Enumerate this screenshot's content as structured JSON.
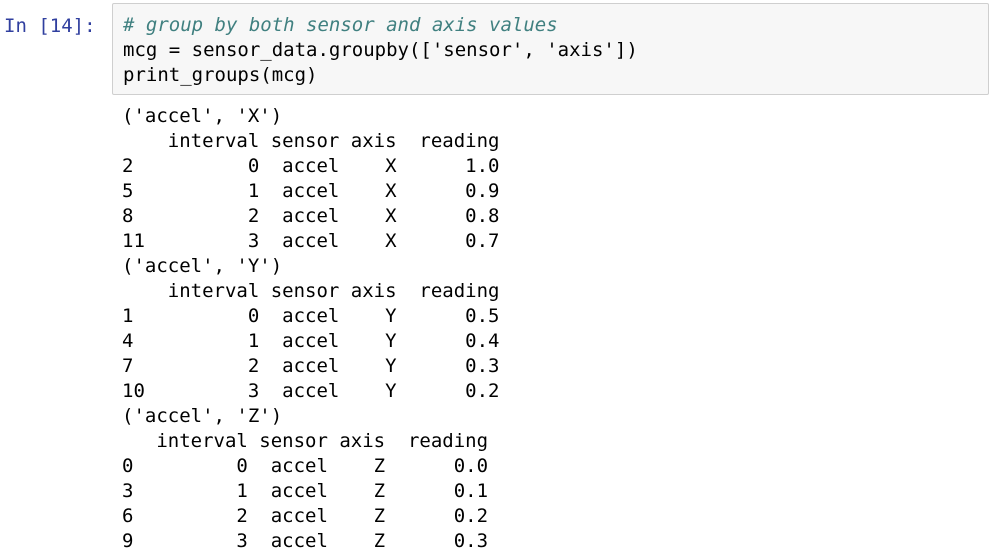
{
  "cell": {
    "prompt": "In [14]:",
    "code_lines": [
      "# group by both sensor and axis values",
      "mcg = sensor_data.groupby(['sensor', 'axis'])",
      "print_groups(mcg)"
    ]
  },
  "output": {
    "groups": [
      {
        "title": "('accel', 'X')",
        "header": "    interval sensor axis  reading",
        "rows": [
          "2          0  accel    X      1.0",
          "5          1  accel    X      0.9",
          "8          2  accel    X      0.8",
          "11         3  accel    X      0.7"
        ]
      },
      {
        "title": "('accel', 'Y')",
        "header": "    interval sensor axis  reading",
        "rows": [
          "1          0  accel    Y      0.5",
          "4          1  accel    Y      0.4",
          "7          2  accel    Y      0.3",
          "10         3  accel    Y      0.2"
        ]
      },
      {
        "title": "('accel', 'Z')",
        "header": "   interval sensor axis  reading",
        "rows": [
          "0         0  accel    Z      0.0",
          "3         1  accel    Z      0.1",
          "6         2  accel    Z      0.2",
          "9         3  accel    Z      0.3"
        ]
      }
    ]
  }
}
